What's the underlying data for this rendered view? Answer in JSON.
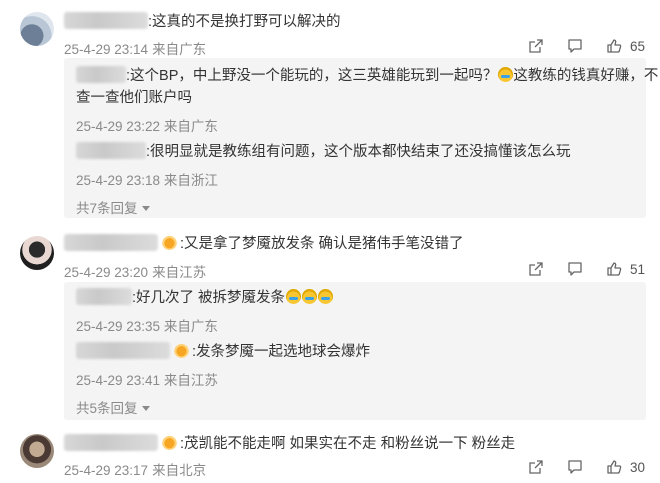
{
  "comments": [
    {
      "text": ":这真的不是换打野可以解决的",
      "date": "25-4-29 23:14",
      "location": "来自广东",
      "likes": "65",
      "replies": [
        {
          "text_line1": ":这个BP，中上野没一个能玩的，这三英雄能玩到一起吗？",
          "text_line1b": "这教练的钱真好赚，不",
          "text_line2": "查一查他们账户吗",
          "date": "25-4-29 23:22",
          "location": "来自广东"
        },
        {
          "text_line1": ":很明显就是教练组有问题，这个版本都快结束了还没搞懂该怎么玩",
          "date": "25-4-29 23:18",
          "location": "来自浙江"
        }
      ],
      "more_replies": "共7条回复"
    },
    {
      "text": ":又是拿了梦魇放发条 确认是猪伟手笔没错了",
      "date": "25-4-29 23:20",
      "location": "来自江苏",
      "likes": "51",
      "replies": [
        {
          "text_line1": ":好几次了 被拆梦魇发条",
          "date": "25-4-29 23:35",
          "location": "来自广东"
        },
        {
          "text_line1": ":发条梦魇一起选地球会爆炸",
          "date": "25-4-29 23:41",
          "location": "来自江苏"
        }
      ],
      "more_replies": "共5条回复"
    },
    {
      "text": ":茂凯能不能走啊 如果实在不走 和粉丝说一下 粉丝走",
      "date": "25-4-29 23:17",
      "location": "来自北京",
      "likes": "30"
    }
  ],
  "icons": {
    "share": "share-icon",
    "comment": "comment-icon",
    "like": "thumbs-up-icon",
    "expand": "chevron-down-icon"
  },
  "colors": {
    "meta_text": "#8a8a8a",
    "reply_bg": "#f4f4f4",
    "crown": "#f6a623"
  }
}
